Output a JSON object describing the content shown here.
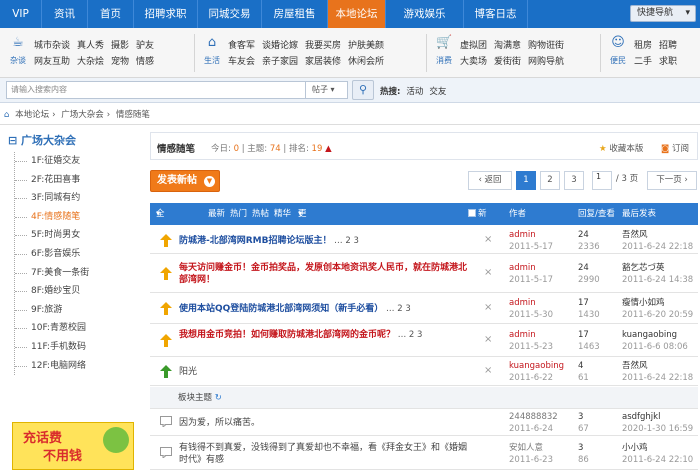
{
  "nav": {
    "items": [
      "VIP",
      "资讯",
      "首页",
      "招聘求职",
      "同城交易",
      "房屋租售",
      "本地论坛",
      "游戏娱乐",
      "博客日志"
    ],
    "active_index": 6,
    "quick_nav": "快捷导航"
  },
  "categories": [
    {
      "label": "杂谈",
      "links": [
        "城市杂谈",
        "真人秀",
        "摄影",
        "驴友",
        "网友互助",
        "大杂烩",
        "宠物",
        "情感"
      ]
    },
    {
      "label": "生活",
      "links": [
        "食客军",
        "谈婚论嫁",
        "我要买房",
        "护肤美颜",
        "车友会",
        "亲子家园",
        "家居装修",
        "休闲会所"
      ]
    },
    {
      "label": "消费",
      "links": [
        "虚拟团",
        "淘满意",
        "购物诳街",
        "大卖场",
        "爱街街",
        "网购导航"
      ]
    },
    {
      "label": "便民",
      "links": [
        "租房",
        "招聘",
        "二手",
        "求职"
      ]
    }
  ],
  "search": {
    "placeholder": "请输入搜索内容",
    "scope": "帖子",
    "hot_label": "热搜:",
    "hot_links": [
      "活动",
      "交友"
    ]
  },
  "breadcrumb": [
    "本地论坛",
    "›",
    "广场大杂会",
    "›",
    "情感随笔"
  ],
  "sidebar": {
    "title": "广场大杂会",
    "items": [
      "1F:征婚交友",
      "2F:花田喜事",
      "3F:同城有约",
      "4F:情感随笔",
      "5F:时尚男女",
      "6F:影音娱乐",
      "7F:美食一条街",
      "8F:婚纱宝贝",
      "9F:旅游",
      "10F:青葱校园",
      "11F:手机数码",
      "12F:电脑网络"
    ],
    "current_index": 3
  },
  "ad": {
    "line1": "充话费",
    "line2": "不用钱"
  },
  "forum": {
    "name": "情感随笔",
    "today_label": "今日:",
    "today": "0",
    "topics_label": "主题:",
    "topics": "74",
    "rank_label": "排名:",
    "rank": "19",
    "favorite": "收藏本版",
    "rss": "订阅"
  },
  "toolbar": {
    "new_post": "发表新帖",
    "back": "‹ 返回",
    "pages": [
      "1",
      "2",
      "3"
    ],
    "page_input": "1",
    "total": "/ 3 页",
    "next": "下一页 ›"
  },
  "table_header": {
    "all": "全部主题",
    "tabs": [
      "最新",
      "热门",
      "热帖",
      "精华",
      "更多"
    ],
    "new_window": "新窗",
    "author": "作者",
    "replies": "回复/查看",
    "last_post": "最后发表"
  },
  "rows": [
    {
      "title": "防城港-北部湾网RMB招聘论坛版主！",
      "pages": "… 2 3",
      "style": "blue",
      "author": "admin",
      "date": "2011-5-17",
      "replies": "24",
      "views": "2336",
      "last_user": "吾然风",
      "last_date": "2011-6-24 22:18"
    },
    {
      "title": "每天访问赚金币！金币拍奖品，发原创本地资讯奖人民币，就在防城港北部湾网！",
      "pages": "",
      "style": "red",
      "author": "admin",
      "date": "2011-5-17",
      "replies": "24",
      "views": "2990",
      "last_user": "豁乞芯づ英",
      "last_date": "2011-6-24 14:38"
    },
    {
      "title": "使用本站QQ登陆防城港北部湾网须知（新手必看）",
      "pages": "… 2 3",
      "style": "blue",
      "author": "admin",
      "date": "2011-5-30",
      "replies": "17",
      "views": "1430",
      "last_user": "瘦情小如鸡",
      "last_date": "2011-6-20 20:59"
    },
    {
      "title": "我想用金币竞拍！如何赚取防城港北部湾网的金币呢？",
      "pages": "… 2 3",
      "style": "red",
      "author": "admin",
      "date": "2011-5-23",
      "replies": "17",
      "views": "1463",
      "last_user": "kuangaobing",
      "last_date": "2011-6-6 08:06"
    },
    {
      "title": "阳光",
      "pages": "",
      "style": "plain",
      "author": "kuangaobing",
      "date": "2011-6-22",
      "replies": "4",
      "views": "61",
      "last_user": "吾然风",
      "last_date": "2011-6-24 22:18"
    },
    {
      "title": "因为爱，所以痛苦。",
      "pages": "",
      "style": "plain",
      "author": "244888832",
      "date": "2011-6-24",
      "replies": "3",
      "views": "67",
      "last_user": "asdfghjkl",
      "last_date": "2020-1-30 16:59"
    },
    {
      "title": "有钱得不到真爱，没钱得到了真爱却也不幸福，看《拜金女王》和《婚姻时代》有感",
      "pages": "",
      "style": "plain",
      "author": "安如人意",
      "date": "2011-6-23",
      "replies": "3",
      "views": "86",
      "last_user": "小小鸡",
      "last_date": "2011-6-24 22:10"
    }
  ],
  "section_label": "板块主题",
  "colors": {
    "nav": "#1a6fc6",
    "active": "#e8731c",
    "header": "#2e7bd0",
    "link": "#1f4fa0",
    "hot": "#c4161c"
  }
}
